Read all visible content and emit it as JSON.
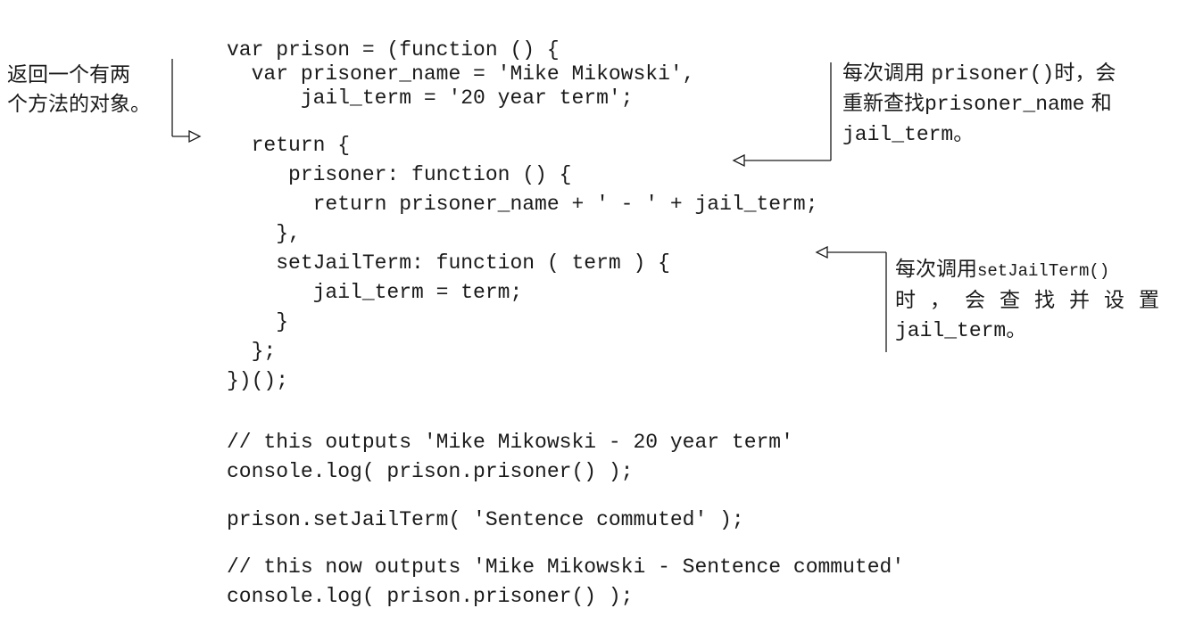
{
  "code": {
    "block1": [
      "var prison = (function () {",
      "  var prisoner_name = 'Mike Mikowski',",
      "      jail_term = '20 year term';",
      "  return {",
      "     prisoner: function () {",
      "       return prisoner_name + ' - ' + jail_term;",
      "    },",
      "    setJailTerm: function ( term ) {",
      "       jail_term = term;",
      "    }",
      "  };",
      "})();"
    ],
    "block2": [
      "// this outputs 'Mike Mikowski - 20 year term'",
      "console.log( prison.prisoner() );"
    ],
    "block3": [
      "prison.setJailTerm( 'Sentence commuted' );"
    ],
    "block4": [
      "// this now outputs 'Mike Mikowski - Sentence commuted'",
      "console.log( prison.prisoner() );"
    ]
  },
  "annotations": {
    "left": {
      "line1": "返回一个有两",
      "line2": "个方法的对象。"
    },
    "right_top": {
      "line1_prefix": "每次调用 ",
      "line1_code": "prisoner()",
      "line1_suffix": "时，会",
      "line2_prefix": "重新查找",
      "line2_code": "prisoner_name",
      "line2_suffix": " 和",
      "line3_code": "jail_term",
      "line3_suffix": "。"
    },
    "right_bottom": {
      "line1_prefix": "每次调用",
      "line1_code": "setJailTerm()",
      "line2": "时，会查找并设置",
      "line3_code": "jail_term",
      "line3_suffix": "。"
    }
  }
}
